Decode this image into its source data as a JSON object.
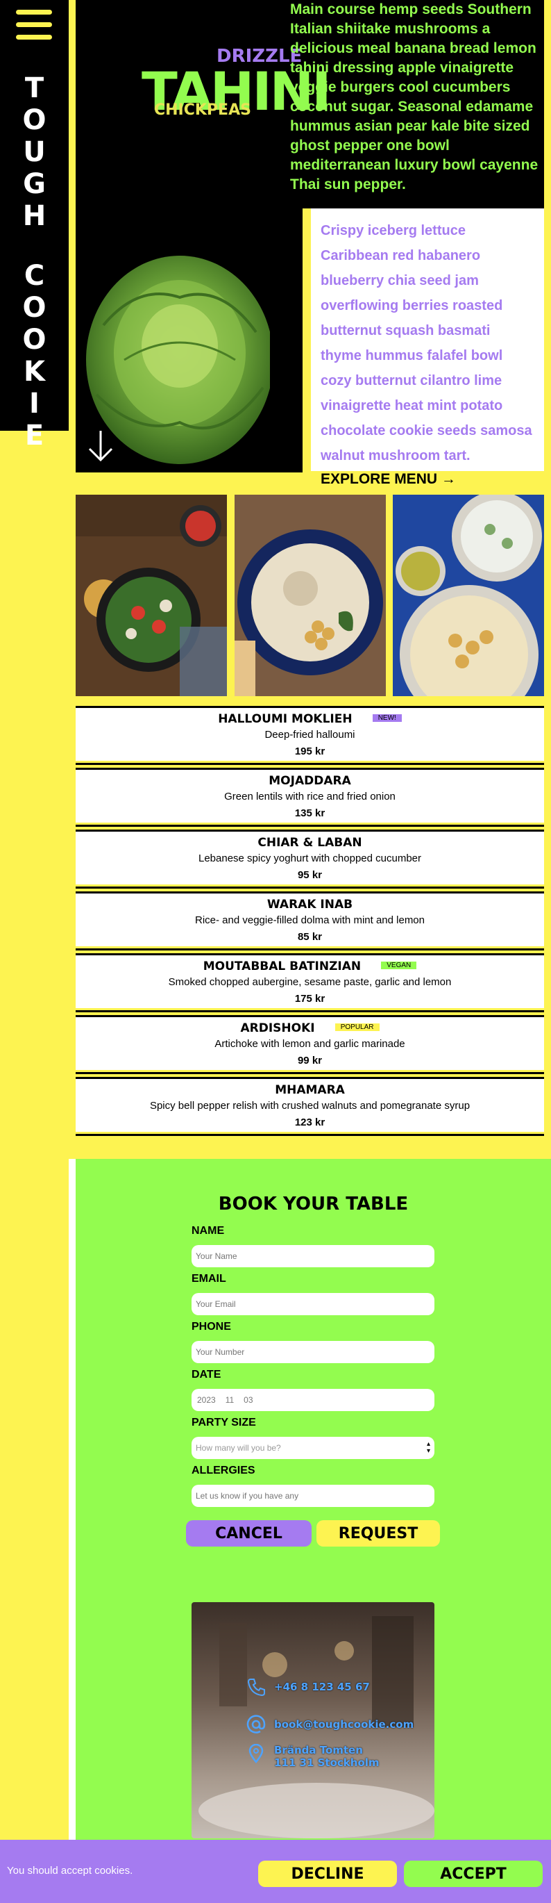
{
  "brand": {
    "letters": [
      "T",
      "O",
      "U",
      "G",
      "H",
      "",
      "C",
      "O",
      "O",
      "K",
      "I",
      "E"
    ]
  },
  "hero": {
    "drizzle": "DRIZZLE",
    "tahini": "TAHINI",
    "chickpeas": "CHICKPEAS",
    "intro": "Main course hemp seeds Southern Italian shiitake mushrooms a delicious meal banana bread lemon tahini dressing apple vinaigrette veggie burgers cool cucumbers coconut sugar. Seasonal edamame hummus asian pear kale bite sized ghost pepper one bowl mediterranean luxury bowl cayenne Thai sun pepper.",
    "secondary": "Crispy iceberg lettuce Caribbean red habanero blueberry chia seed jam overflowing berries roasted butternut squash basmati thyme hummus falafel bowl cozy butternut cilantro lime vinaigrette heat mint potato chocolate cookie seeds samosa walnut mushroom tart.",
    "explore_label": "EXPLORE MENU →"
  },
  "menu": [
    {
      "name": "HALLOUMI MOKLIEH",
      "badge": "NEW!",
      "badge_color": "#a57bf0",
      "desc": "Deep-fried halloumi",
      "price": "195 kr"
    },
    {
      "name": "MOJADDARA",
      "badge": "",
      "desc": "Green lentils with rice and fried onion",
      "price": "135 kr"
    },
    {
      "name": "CHIAR & LABAN",
      "badge": "",
      "desc": "Lebanese spicy yoghurt with chopped cucumber",
      "price": "95 kr"
    },
    {
      "name": "WARAK INAB",
      "badge": "",
      "desc": "Rice- and veggie-filled dolma with mint and lemon",
      "price": "85 kr"
    },
    {
      "name": "MOUTABBAL BATINZIAN",
      "badge": "VEGAN",
      "badge_color": "#93fc4f",
      "desc": "Smoked chopped aubergine, sesame paste, garlic and lemon",
      "price": "175 kr"
    },
    {
      "name": "ARDISHOKI",
      "badge": "POPULAR",
      "badge_color": "#fdf351",
      "desc": "Artichoke with lemon and garlic marinade",
      "price": "99 kr"
    },
    {
      "name": "MHAMARA",
      "badge": "",
      "desc": "Spicy bell pepper relish with crushed walnuts and pomegranate syrup",
      "price": "123 kr"
    }
  ],
  "booking": {
    "title": "BOOK YOUR TABLE",
    "name_label": "NAME",
    "name_placeholder": "Your Name",
    "email_label": "EMAIL",
    "email_placeholder": "Your Email",
    "phone_label": "PHONE",
    "phone_placeholder": "Your Number",
    "date_label": "DATE",
    "date_year": "2023",
    "date_month": "11",
    "date_day": "03",
    "party_label": "PARTY SIZE",
    "party_placeholder": "How many will you be?",
    "allergies_label": "ALLERGIES",
    "allergies_placeholder": "Let us know if you have any",
    "cancel_label": "CANCEL",
    "request_label": "REQUEST"
  },
  "contact": {
    "phone": "+46 8 123 45 67",
    "email": "book@toughcookie.com",
    "address_line1": "Brända Tomten",
    "address_line2": "111 31 Stockholm"
  },
  "cookie": {
    "text": "You should accept cookies.",
    "decline_label": "DECLINE",
    "accept_label": "ACCEPT"
  },
  "colors": {
    "yellow": "#fdf351",
    "green": "#93fc4f",
    "purple": "#a57bf0",
    "black": "#000000"
  }
}
